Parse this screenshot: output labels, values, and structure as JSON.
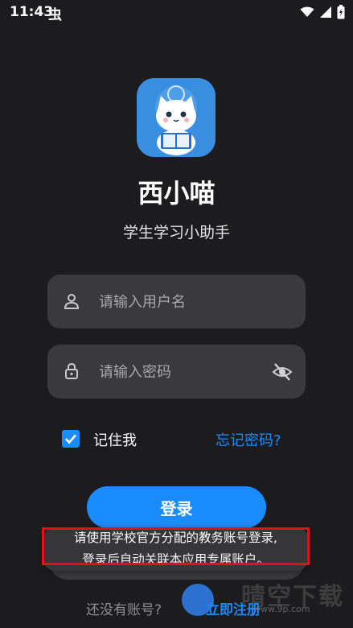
{
  "status_bar": {
    "time": "11:43",
    "app_glyph": "虫"
  },
  "app": {
    "name": "西小喵",
    "subtitle": "学生学习小助手",
    "logo_icon": "cat-reading-logo"
  },
  "form": {
    "username_placeholder": "请输入用户名",
    "password_placeholder": "请输入密码",
    "remember_label": "记住我",
    "remember_checked": true,
    "forgot_label": "忘记密码?",
    "login_label": "登录"
  },
  "toast": {
    "line1": "请使用学校官方分配的教务账号登录,",
    "line2": "登录后自动关联本应用专属账户。"
  },
  "footer": {
    "no_account": "还没有账号?",
    "register": "立即注册"
  },
  "watermark": {
    "text": "晴空下载",
    "url": "www.9p.com"
  },
  "colors": {
    "background": "#1c1c1e",
    "field": "#3a3a3c",
    "accent": "#1a8cff",
    "highlight": "#e0111a"
  }
}
